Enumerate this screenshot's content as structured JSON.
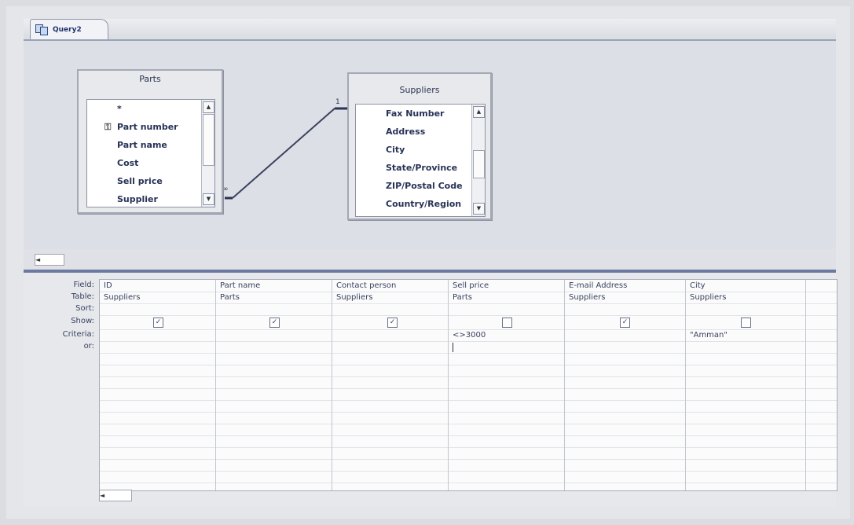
{
  "tab": {
    "label": "Query2",
    "icon": "query-icon"
  },
  "tables": [
    {
      "title": "Parts",
      "fields": [
        "*",
        "Part number",
        "Part name",
        "Cost",
        "Sell price",
        "Supplier"
      ],
      "key_field": "Part number"
    },
    {
      "title": "Suppliers",
      "fields": [
        "Fax Number",
        "Address",
        "City",
        "State/Province",
        "ZIP/Postal Code",
        "Country/Region"
      ]
    }
  ],
  "relationship": {
    "one_side": "1",
    "many_side": "∞"
  },
  "grid": {
    "row_labels": [
      "Field:",
      "Table:",
      "Sort:",
      "Show:",
      "Criteria:",
      "or:"
    ],
    "columns": [
      {
        "field": "ID",
        "table": "Suppliers",
        "show": true,
        "criteria": ""
      },
      {
        "field": "Part name",
        "table": "Parts",
        "show": true,
        "criteria": ""
      },
      {
        "field": "Contact person",
        "table": "Suppliers",
        "show": true,
        "criteria": ""
      },
      {
        "field": "Sell price",
        "table": "Parts",
        "show": false,
        "criteria": "<>3000"
      },
      {
        "field": "E-mail Address",
        "table": "Suppliers",
        "show": true,
        "criteria": ""
      },
      {
        "field": "City",
        "table": "Suppliers",
        "show": false,
        "criteria": "\"Amman\""
      },
      {
        "field": "",
        "table": "",
        "show": false,
        "criteria": ""
      }
    ]
  },
  "scroll_left_glyph": "◄",
  "scroll_up_glyph": "▲",
  "scroll_down_glyph": "▼",
  "check_glyph": "✓",
  "colors": {
    "separator": "#6d7aa0",
    "grid_bg": "#fbfbfc"
  }
}
